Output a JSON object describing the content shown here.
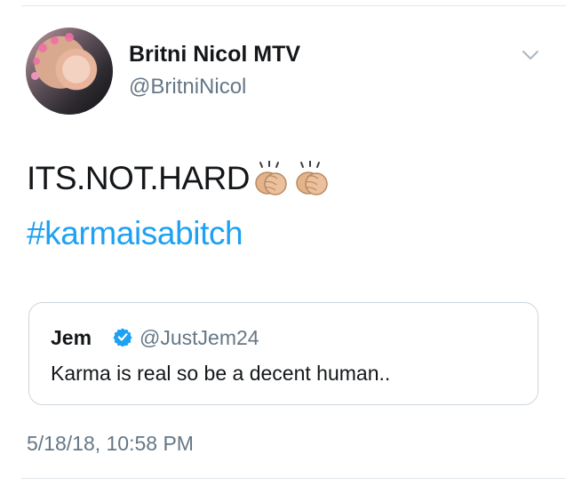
{
  "tweet": {
    "author_name": "Britni Nicol MTV",
    "author_handle": "@BritniNicol",
    "text": "ITS.NOT.HARD",
    "hashtag": "#karmaisabitch",
    "timestamp": "5/18/18, 10:58 PM",
    "emoji": [
      "clapping-hands-icon",
      "clapping-hands-icon"
    ],
    "menu_icon": "chevron-down-icon"
  },
  "quoted_tweet": {
    "author_name": "Jem",
    "verified_icon": "verified-badge-icon",
    "author_handle": "@JustJem24",
    "text": "Karma is real so be a decent human.."
  },
  "colors": {
    "link": "#1da1f2",
    "secondary_text": "#657786",
    "primary_text": "#14171a",
    "divider": "#e1e8ed"
  }
}
